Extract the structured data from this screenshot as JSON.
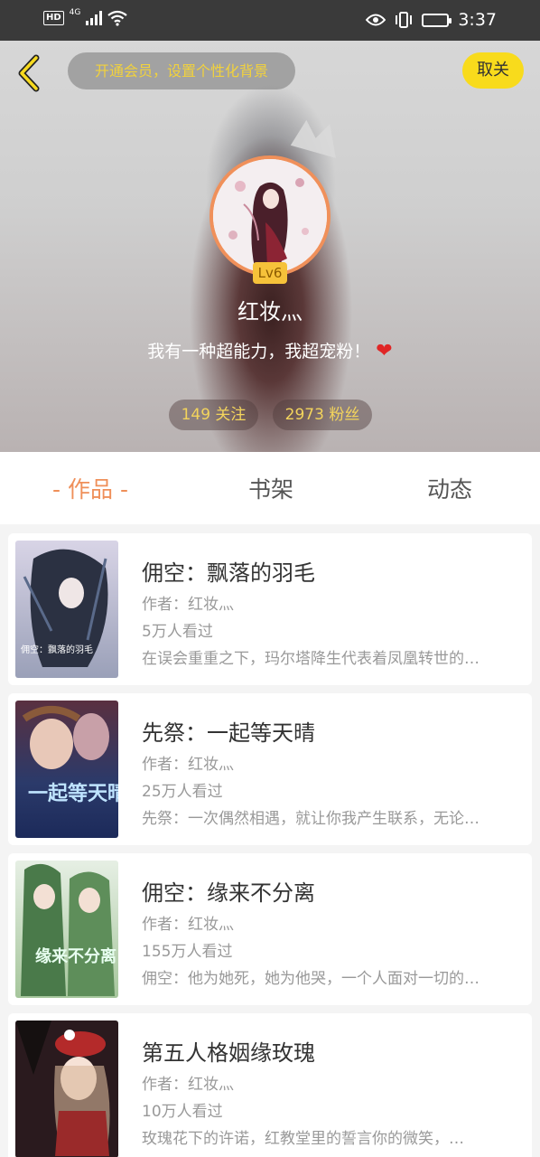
{
  "status_bar": {
    "left_badge": "HD",
    "network": "4G",
    "time": "3:37"
  },
  "header": {
    "vip_prompt": "开通会员，设置个性化背景",
    "cancel_label": "取关",
    "level": "Lv6",
    "username": "红妆灬",
    "bio": "我有一种超能力，我超宠粉！",
    "heart": "❤",
    "following": "149 关注",
    "fans": "2973 粉丝"
  },
  "tabs": [
    {
      "label": "- 作品 -",
      "active": true
    },
    {
      "label": "书架",
      "active": false
    },
    {
      "label": "动态",
      "active": false
    }
  ],
  "works": [
    {
      "title": "佣空：飘落的羽毛",
      "author": "作者：红妆灬",
      "views": "5万人看过",
      "desc": "在误会重重之下，玛尔塔降生代表着凤凰转世的…",
      "cover_text": "佣空：飘落的羽毛"
    },
    {
      "title": "先祭：一起等天晴",
      "author": "作者：红妆灬",
      "views": "25万人看过",
      "desc": "先祭：一次偶然相遇，就让你我产生联系，无论…",
      "cover_text": "一起等天晴"
    },
    {
      "title": "佣空：缘来不分离",
      "author": "作者：红妆灬",
      "views": "155万人看过",
      "desc": "佣空：他为她死，她为他哭，一个人面对一切的…",
      "cover_text": "缘来不分离"
    },
    {
      "title": "第五人格姻缘玫瑰",
      "author": "作者：红妆灬",
      "views": "10万人看过",
      "desc": "玫瑰花下的许诺，红教堂里的誓言你的微笑，…",
      "cover_text": ""
    }
  ],
  "colors": {
    "accent": "#ef8f59",
    "vip_text": "#f2d23c",
    "cancel_bg": "#f8db1c",
    "stat_text": "#f3d45c",
    "level_bg": "#f6c23a"
  }
}
